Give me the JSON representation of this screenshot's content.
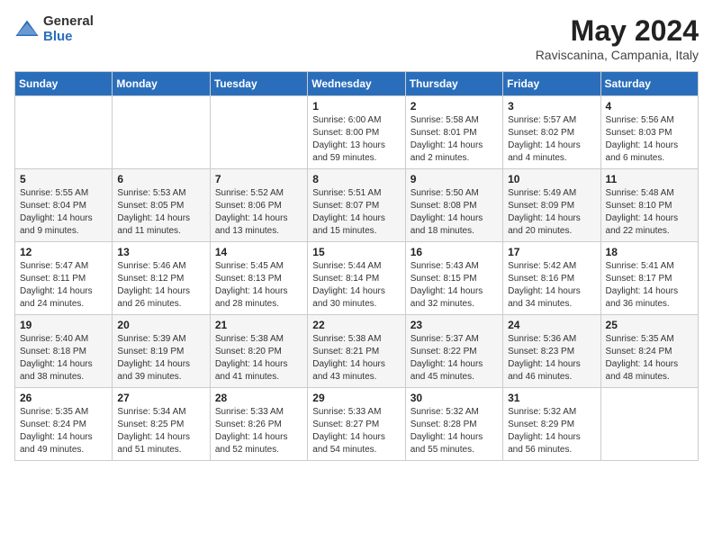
{
  "header": {
    "logo_general": "General",
    "logo_blue": "Blue",
    "month_year": "May 2024",
    "location": "Raviscanina, Campania, Italy"
  },
  "days_of_week": [
    "Sunday",
    "Monday",
    "Tuesday",
    "Wednesday",
    "Thursday",
    "Friday",
    "Saturday"
  ],
  "weeks": [
    [
      {
        "day": "",
        "sunrise": "",
        "sunset": "",
        "daylight": ""
      },
      {
        "day": "",
        "sunrise": "",
        "sunset": "",
        "daylight": ""
      },
      {
        "day": "",
        "sunrise": "",
        "sunset": "",
        "daylight": ""
      },
      {
        "day": "1",
        "sunrise": "Sunrise: 6:00 AM",
        "sunset": "Sunset: 8:00 PM",
        "daylight": "Daylight: 13 hours and 59 minutes."
      },
      {
        "day": "2",
        "sunrise": "Sunrise: 5:58 AM",
        "sunset": "Sunset: 8:01 PM",
        "daylight": "Daylight: 14 hours and 2 minutes."
      },
      {
        "day": "3",
        "sunrise": "Sunrise: 5:57 AM",
        "sunset": "Sunset: 8:02 PM",
        "daylight": "Daylight: 14 hours and 4 minutes."
      },
      {
        "day": "4",
        "sunrise": "Sunrise: 5:56 AM",
        "sunset": "Sunset: 8:03 PM",
        "daylight": "Daylight: 14 hours and 6 minutes."
      }
    ],
    [
      {
        "day": "5",
        "sunrise": "Sunrise: 5:55 AM",
        "sunset": "Sunset: 8:04 PM",
        "daylight": "Daylight: 14 hours and 9 minutes."
      },
      {
        "day": "6",
        "sunrise": "Sunrise: 5:53 AM",
        "sunset": "Sunset: 8:05 PM",
        "daylight": "Daylight: 14 hours and 11 minutes."
      },
      {
        "day": "7",
        "sunrise": "Sunrise: 5:52 AM",
        "sunset": "Sunset: 8:06 PM",
        "daylight": "Daylight: 14 hours and 13 minutes."
      },
      {
        "day": "8",
        "sunrise": "Sunrise: 5:51 AM",
        "sunset": "Sunset: 8:07 PM",
        "daylight": "Daylight: 14 hours and 15 minutes."
      },
      {
        "day": "9",
        "sunrise": "Sunrise: 5:50 AM",
        "sunset": "Sunset: 8:08 PM",
        "daylight": "Daylight: 14 hours and 18 minutes."
      },
      {
        "day": "10",
        "sunrise": "Sunrise: 5:49 AM",
        "sunset": "Sunset: 8:09 PM",
        "daylight": "Daylight: 14 hours and 20 minutes."
      },
      {
        "day": "11",
        "sunrise": "Sunrise: 5:48 AM",
        "sunset": "Sunset: 8:10 PM",
        "daylight": "Daylight: 14 hours and 22 minutes."
      }
    ],
    [
      {
        "day": "12",
        "sunrise": "Sunrise: 5:47 AM",
        "sunset": "Sunset: 8:11 PM",
        "daylight": "Daylight: 14 hours and 24 minutes."
      },
      {
        "day": "13",
        "sunrise": "Sunrise: 5:46 AM",
        "sunset": "Sunset: 8:12 PM",
        "daylight": "Daylight: 14 hours and 26 minutes."
      },
      {
        "day": "14",
        "sunrise": "Sunrise: 5:45 AM",
        "sunset": "Sunset: 8:13 PM",
        "daylight": "Daylight: 14 hours and 28 minutes."
      },
      {
        "day": "15",
        "sunrise": "Sunrise: 5:44 AM",
        "sunset": "Sunset: 8:14 PM",
        "daylight": "Daylight: 14 hours and 30 minutes."
      },
      {
        "day": "16",
        "sunrise": "Sunrise: 5:43 AM",
        "sunset": "Sunset: 8:15 PM",
        "daylight": "Daylight: 14 hours and 32 minutes."
      },
      {
        "day": "17",
        "sunrise": "Sunrise: 5:42 AM",
        "sunset": "Sunset: 8:16 PM",
        "daylight": "Daylight: 14 hours and 34 minutes."
      },
      {
        "day": "18",
        "sunrise": "Sunrise: 5:41 AM",
        "sunset": "Sunset: 8:17 PM",
        "daylight": "Daylight: 14 hours and 36 minutes."
      }
    ],
    [
      {
        "day": "19",
        "sunrise": "Sunrise: 5:40 AM",
        "sunset": "Sunset: 8:18 PM",
        "daylight": "Daylight: 14 hours and 38 minutes."
      },
      {
        "day": "20",
        "sunrise": "Sunrise: 5:39 AM",
        "sunset": "Sunset: 8:19 PM",
        "daylight": "Daylight: 14 hours and 39 minutes."
      },
      {
        "day": "21",
        "sunrise": "Sunrise: 5:38 AM",
        "sunset": "Sunset: 8:20 PM",
        "daylight": "Daylight: 14 hours and 41 minutes."
      },
      {
        "day": "22",
        "sunrise": "Sunrise: 5:38 AM",
        "sunset": "Sunset: 8:21 PM",
        "daylight": "Daylight: 14 hours and 43 minutes."
      },
      {
        "day": "23",
        "sunrise": "Sunrise: 5:37 AM",
        "sunset": "Sunset: 8:22 PM",
        "daylight": "Daylight: 14 hours and 45 minutes."
      },
      {
        "day": "24",
        "sunrise": "Sunrise: 5:36 AM",
        "sunset": "Sunset: 8:23 PM",
        "daylight": "Daylight: 14 hours and 46 minutes."
      },
      {
        "day": "25",
        "sunrise": "Sunrise: 5:35 AM",
        "sunset": "Sunset: 8:24 PM",
        "daylight": "Daylight: 14 hours and 48 minutes."
      }
    ],
    [
      {
        "day": "26",
        "sunrise": "Sunrise: 5:35 AM",
        "sunset": "Sunset: 8:24 PM",
        "daylight": "Daylight: 14 hours and 49 minutes."
      },
      {
        "day": "27",
        "sunrise": "Sunrise: 5:34 AM",
        "sunset": "Sunset: 8:25 PM",
        "daylight": "Daylight: 14 hours and 51 minutes."
      },
      {
        "day": "28",
        "sunrise": "Sunrise: 5:33 AM",
        "sunset": "Sunset: 8:26 PM",
        "daylight": "Daylight: 14 hours and 52 minutes."
      },
      {
        "day": "29",
        "sunrise": "Sunrise: 5:33 AM",
        "sunset": "Sunset: 8:27 PM",
        "daylight": "Daylight: 14 hours and 54 minutes."
      },
      {
        "day": "30",
        "sunrise": "Sunrise: 5:32 AM",
        "sunset": "Sunset: 8:28 PM",
        "daylight": "Daylight: 14 hours and 55 minutes."
      },
      {
        "day": "31",
        "sunrise": "Sunrise: 5:32 AM",
        "sunset": "Sunset: 8:29 PM",
        "daylight": "Daylight: 14 hours and 56 minutes."
      },
      {
        "day": "",
        "sunrise": "",
        "sunset": "",
        "daylight": ""
      }
    ]
  ]
}
